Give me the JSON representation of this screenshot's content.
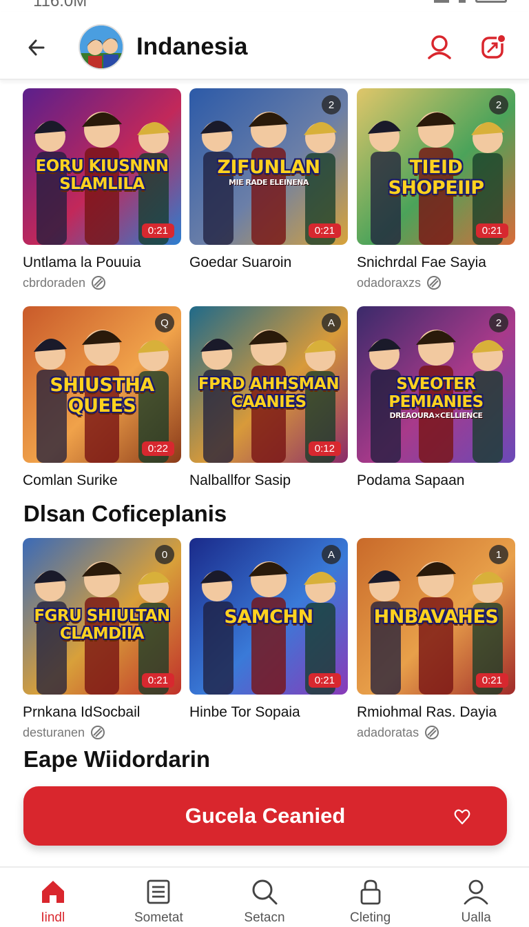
{
  "status_bar": {
    "time": "116.0M"
  },
  "header": {
    "title": "Indanesia",
    "back_icon": "arrow-left-icon",
    "search_icon": "person-search-icon",
    "notification_icon": "bell-badge-icon",
    "accent_color": "#d9262d"
  },
  "grid_rows": [
    {
      "cards": [
        {
          "thumb_title": "EORU KIUSNNN SLAMLILA",
          "thumb_subtitle": "",
          "duration": "0:21",
          "badge": "",
          "title": "Untlama la Pouuia",
          "meta": "cbrdoraden",
          "colors": [
            "#5b1f8c",
            "#c2285a",
            "#2b7fd1"
          ]
        },
        {
          "thumb_title": "ZIFUNLAN",
          "thumb_subtitle": "MIE RADE ELEINENA",
          "duration": "0:21",
          "badge": "2",
          "title": "Goedar Suaroin",
          "meta": "",
          "colors": [
            "#2c5aa8",
            "#6b7fa8",
            "#d8a33a"
          ]
        },
        {
          "thumb_title": "TIEID SHOPEIIP",
          "thumb_subtitle": "",
          "duration": "0:21",
          "badge": "2",
          "title": "Snichrdal Fae Sayia",
          "meta": "odadoraxzs",
          "colors": [
            "#e0c66a",
            "#4ba35a",
            "#d86b3a"
          ]
        }
      ]
    },
    {
      "cards": [
        {
          "thumb_title": "SHIUSTHA QUEES",
          "thumb_subtitle": "",
          "duration": "0:22",
          "badge": "Q",
          "title": "Comlan Surike",
          "meta": "",
          "colors": [
            "#c95a2a",
            "#f0a24a",
            "#8a3a1a"
          ]
        },
        {
          "thumb_title": "FPRD AHHSMAN CAANIES",
          "thumb_subtitle": "",
          "duration": "0:12",
          "badge": "A",
          "title": "Nalballfor Sasip",
          "meta": "",
          "colors": [
            "#1f6a8a",
            "#d89a3a",
            "#8a2a6a"
          ]
        },
        {
          "thumb_title": "SVEOTER PEMIANIES",
          "thumb_subtitle": "DREAOURA×CELLIENCE",
          "duration": "",
          "badge": "2",
          "title": "Podama Sapaan",
          "meta": "",
          "colors": [
            "#3a2a6a",
            "#a83a8a",
            "#6a4ab8"
          ]
        }
      ]
    }
  ],
  "section_heading_1": "Dlsan Coficeplanis",
  "section_row": {
    "cards": [
      {
        "thumb_title": "FGRU SHIULTAN CLAMDIIA",
        "thumb_subtitle": "",
        "duration": "0:21",
        "badge": "0",
        "title": "Prnkana IdSocbail",
        "meta": "desturanen",
        "colors": [
          "#3a6ab8",
          "#d8a03a",
          "#c0302a"
        ]
      },
      {
        "thumb_title": "SAMCHN",
        "thumb_subtitle": "",
        "duration": "0:21",
        "badge": "A",
        "title": "Hinbe Tor Sopaia",
        "meta": "",
        "colors": [
          "#1a2a8a",
          "#3a7ad8",
          "#8a3ab8"
        ]
      },
      {
        "thumb_title": "HNBAVAHES",
        "thumb_subtitle": "",
        "duration": "0:21",
        "badge": "1",
        "title": "Rmiohmal Ras. Dayia",
        "meta": "adadoratas",
        "colors": [
          "#c96a2a",
          "#e8a04a",
          "#a02a2a"
        ]
      }
    ]
  },
  "section_heading_2": "Eape Wiidordarin",
  "cta": {
    "label": "Gucela Ceanied",
    "icon": "heart-outline-icon"
  },
  "bottom_nav": [
    {
      "label": "Iindl",
      "icon": "home-icon",
      "active": true
    },
    {
      "label": "Sometat",
      "icon": "grid-list-icon",
      "active": false
    },
    {
      "label": "Setacn",
      "icon": "search-icon",
      "active": false
    },
    {
      "label": "Cleting",
      "icon": "lock-icon",
      "active": false
    },
    {
      "label": "Ualla",
      "icon": "profile-icon",
      "active": false
    }
  ]
}
